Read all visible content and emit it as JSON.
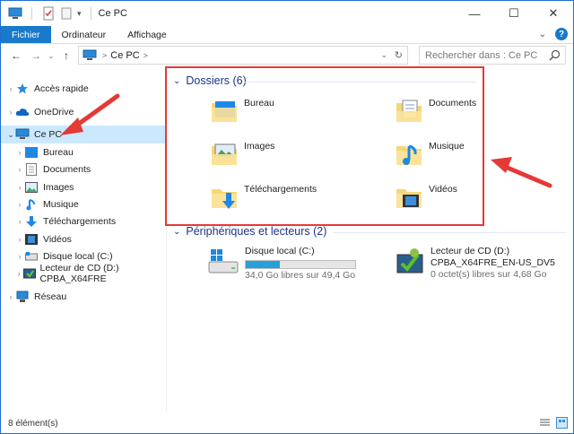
{
  "window": {
    "title": "Ce PC"
  },
  "ribbon": {
    "tabs": [
      "Fichier",
      "Ordinateur",
      "Affichage"
    ]
  },
  "address": {
    "crumb": "Ce PC",
    "search_placeholder": "Rechercher dans : Ce PC"
  },
  "nav": {
    "items": [
      {
        "label": "Accès rapide",
        "icon": "star-icon"
      },
      {
        "label": "OneDrive",
        "icon": "cloud-icon"
      },
      {
        "label": "Ce PC",
        "icon": "computer-icon"
      },
      {
        "label": "Bureau",
        "icon": "desktop-folder-icon"
      },
      {
        "label": "Documents",
        "icon": "documents-icon"
      },
      {
        "label": "Images",
        "icon": "images-icon"
      },
      {
        "label": "Musique",
        "icon": "music-icon"
      },
      {
        "label": "Téléchargements",
        "icon": "download-icon"
      },
      {
        "label": "Vidéos",
        "icon": "videos-icon"
      },
      {
        "label": "Disque local (C:)",
        "icon": "drive-icon"
      },
      {
        "label": "Lecteur de CD (D:) CPBA_X64FRE",
        "icon": "cd-drive-icon"
      },
      {
        "label": "Réseau",
        "icon": "network-icon"
      }
    ]
  },
  "content": {
    "folders_header": "Dossiers (6)",
    "folders": [
      "Bureau",
      "Documents",
      "Images",
      "Musique",
      "Téléchargements",
      "Vidéos"
    ],
    "drives_header": "Périphériques et lecteurs (2)",
    "drives": [
      {
        "name": "Disque local (C:)",
        "free": "34,0 Go libres sur 49,4 Go",
        "used_fraction": 0.31
      },
      {
        "name": "Lecteur de CD (D:)",
        "label": "CPBA_X64FRE_EN-US_DV5",
        "free": "0 octet(s) libres sur 4,68 Go"
      }
    ]
  },
  "status": {
    "count": "8 élément(s)"
  },
  "colors": {
    "accent": "#1979ca",
    "highlight": "#e53935",
    "selection": "#cce8ff"
  }
}
